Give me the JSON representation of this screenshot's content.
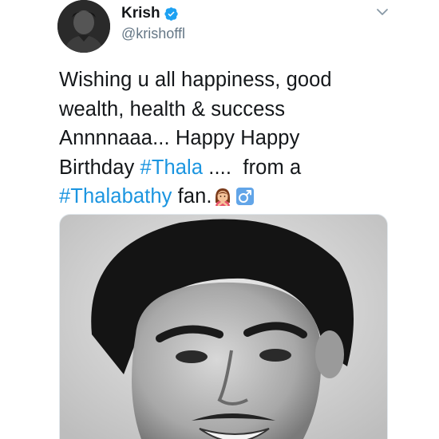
{
  "author": {
    "display_name": "Krish",
    "handle": "@krishoffl",
    "verified": true
  },
  "tweet": {
    "lines": [
      [
        "Wishing u all happiness, good"
      ],
      [
        "wealth, health & success"
      ],
      [
        "Annnnaaa... Happy Happy"
      ],
      [
        "Birthday ",
        "#Thala",
        " ....  from a"
      ],
      [
        "#Thalabathy",
        " fan."
      ]
    ],
    "hashtags": [
      "#Thala",
      "#Thalabathy"
    ],
    "emojis": [
      "woman-gesturing-no-emoji",
      "male-sign-emoji"
    ]
  },
  "media": {
    "type": "photo",
    "description_icon": "portrait-photo"
  },
  "colors": {
    "hashtag": "#1b95e0",
    "verified": "#1da1f2",
    "handle": "#657786",
    "text": "#14171a"
  }
}
